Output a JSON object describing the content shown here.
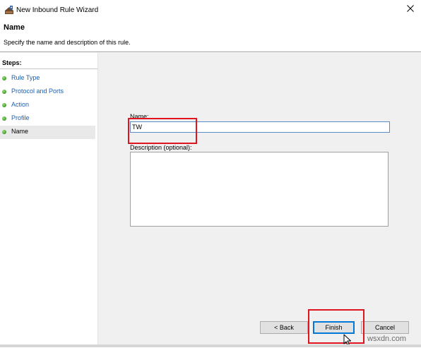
{
  "window": {
    "title": "New Inbound Rule Wizard",
    "icon": "firewall-rule-icon"
  },
  "header": {
    "title": "Name",
    "description": "Specify the name and description of this rule."
  },
  "steps": {
    "title": "Steps:",
    "items": [
      {
        "label": "Rule Type",
        "current": false
      },
      {
        "label": "Protocol and Ports",
        "current": false
      },
      {
        "label": "Action",
        "current": false
      },
      {
        "label": "Profile",
        "current": false
      },
      {
        "label": "Name",
        "current": true
      }
    ]
  },
  "form": {
    "name_label": "Name:",
    "name_value": "TW",
    "description_label": "Description (optional):",
    "description_value": ""
  },
  "buttons": {
    "back": "< Back",
    "finish": "Finish",
    "cancel": "Cancel"
  },
  "watermark": "wsxdn.com",
  "colors": {
    "highlight": "#e0141e",
    "step_dot": "#4aa52e",
    "link": "#1a5fb4",
    "input_border_focus": "#5a8dc8"
  }
}
